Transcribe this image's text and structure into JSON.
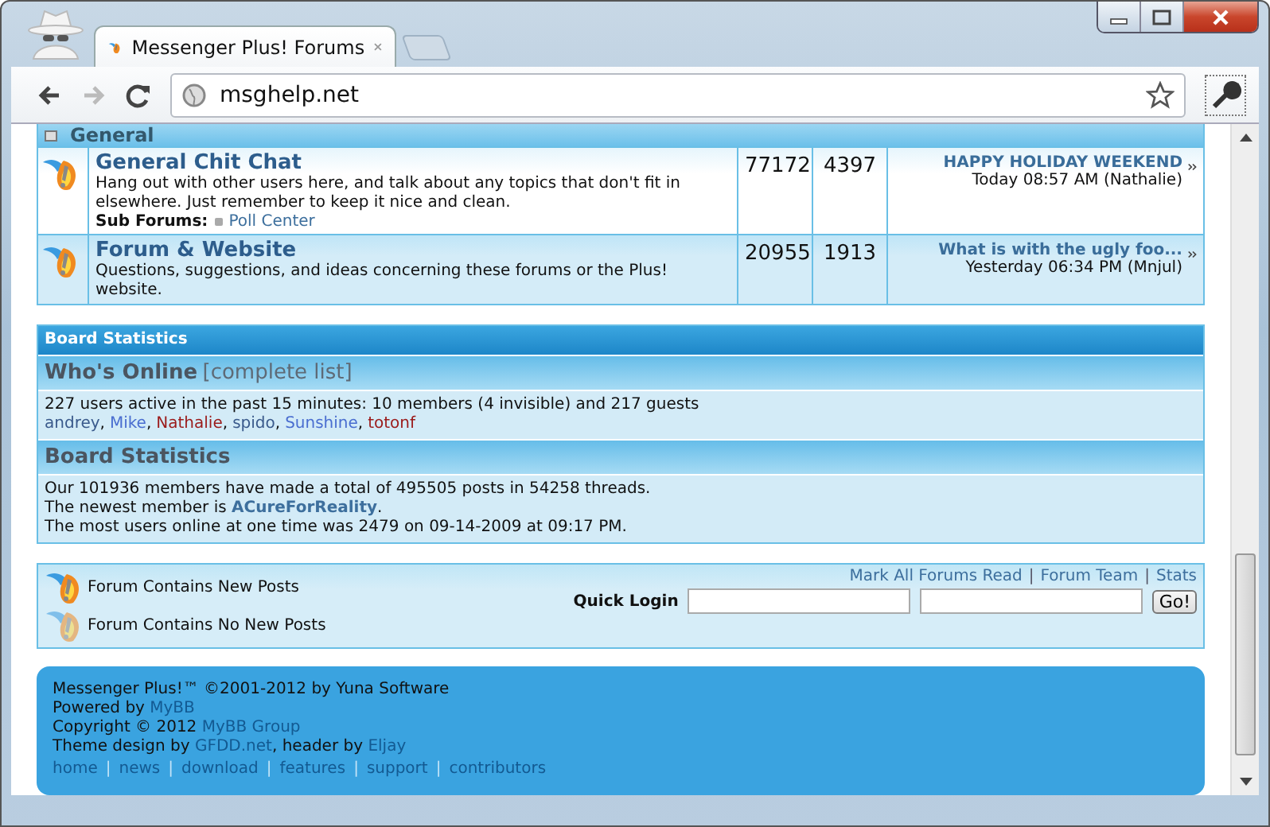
{
  "browser": {
    "tab_title": "Messenger Plus! Forums",
    "url": "msghelp.net"
  },
  "category": {
    "title": "General",
    "expanded": true
  },
  "forums": [
    {
      "name": "General Chit Chat",
      "description": "Hang out with other users here, and talk about any topics that don't fit in elsewhere. Just remember to keep it nice and clean.",
      "subforums_label": "Sub Forums:",
      "subforums": [
        "Poll Center"
      ],
      "posts": "77172",
      "threads": "4397",
      "last_post_title": "HAPPY HOLIDAY WEEKEND",
      "last_post_meta": "Today 08:57 AM (Nathalie)"
    },
    {
      "name": "Forum & Website",
      "description": "Questions, suggestions, and ideas concerning these forums or the Plus! website.",
      "posts": "20955",
      "threads": "1913",
      "last_post_title": "What is with the ugly foo...",
      "last_post_meta": "Yesterday 06:34 PM (Mnjul)"
    }
  ],
  "board_statistics": {
    "title": "Board Statistics",
    "whos_online": {
      "title": "Who's Online",
      "link": "[complete list]",
      "summary": "227 users active in the past 15 minutes: 10 members (4 invisible) and 217 guests",
      "separator": ",",
      "users": [
        {
          "name": "andrey",
          "color": "#3a5a8c"
        },
        {
          "name": "Mike",
          "color": "#4a6ed0"
        },
        {
          "name": "Nathalie",
          "color": "#9b1b1b"
        },
        {
          "name": "spido",
          "color": "#3a5a8c"
        },
        {
          "name": "Sunshine",
          "color": "#4a6ed0"
        },
        {
          "name": "totonf",
          "color": "#9b1b1b"
        }
      ]
    },
    "stats": {
      "title": "Board Statistics",
      "line1": "Our 101936 members have made a total of 495505 posts in 54258 threads.",
      "line2_prefix": "The newest member is",
      "newest_member": "ACureForReality",
      "line2_suffix": ".",
      "line3": "The most users online at one time was 2479 on 09-14-2009 at 09:17 PM."
    }
  },
  "legend": [
    {
      "kind": "new",
      "label": "Forum Contains New Posts"
    },
    {
      "kind": "no_new",
      "label": "Forum Contains No New Posts"
    }
  ],
  "links": [
    "Mark All Forums Read",
    "Forum Team",
    "Stats"
  ],
  "links_separator": "|",
  "quick_login": {
    "label": "Quick Login",
    "button": "Go!"
  },
  "footer": {
    "line1": "Messenger Plus!™ ©2001-2012 by Yuna Software",
    "powered_label": "Powered by",
    "powered_link": "MyBB",
    "copyright_label": "Copyright © 2012",
    "copyright_link": "MyBB Group",
    "theme_label": "Theme design by",
    "theme_link": "GFDD.net",
    "header_label": ", header by",
    "header_link": "Eljay",
    "nav_separator": "|",
    "nav": [
      "home",
      "news",
      "download",
      "features",
      "support",
      "contributors"
    ]
  }
}
